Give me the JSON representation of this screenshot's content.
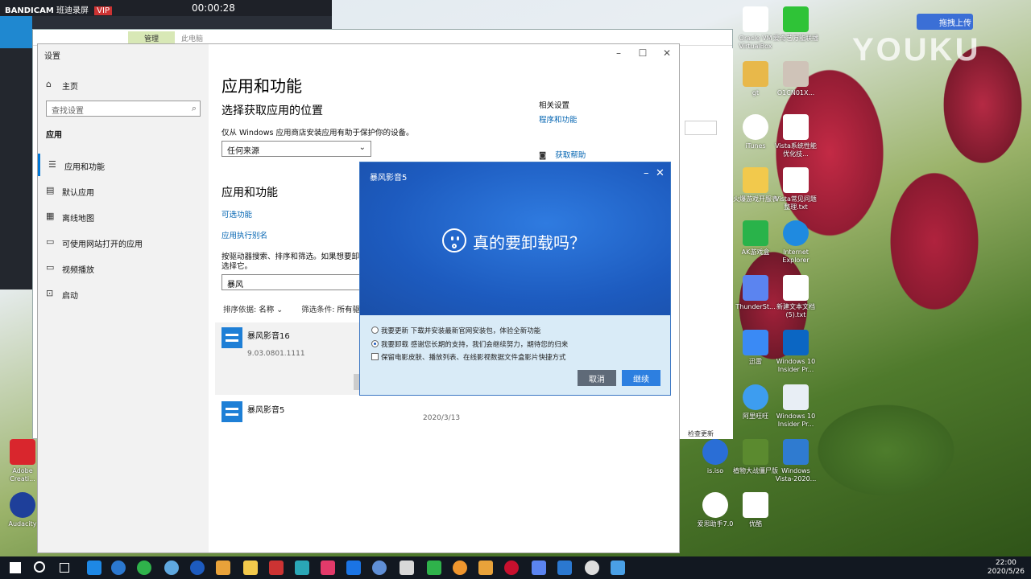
{
  "desktop": {
    "brand": "YOUKU",
    "upload_label": "拖拽上传",
    "icons": [
      {
        "label": "Oracle VM VirtualBox"
      },
      {
        "label": "爱奇艺万能联播"
      },
      {
        "label": "gt"
      },
      {
        "label": "O1CN01X..."
      },
      {
        "label": "iTunes"
      },
      {
        "label": "Vista系统性能优化技..."
      },
      {
        "label": "火爆游戏开服表"
      },
      {
        "label": "Vista常见问题整理.txt"
      },
      {
        "label": "AK游戏盒"
      },
      {
        "label": "Internet Explorer"
      },
      {
        "label": "ThunderSt..."
      },
      {
        "label": "新建文本文档(5).txt"
      },
      {
        "label": "迅雷"
      },
      {
        "label": "Windows 10 Insider Pr..."
      },
      {
        "label": "阿里旺旺"
      },
      {
        "label": "Windows 10 Insider Pr..."
      },
      {
        "label": "is.iso"
      },
      {
        "label": "植物大战僵尸版"
      },
      {
        "label": "Windows Vista-2020..."
      },
      {
        "label": "爱思助手7.0"
      },
      {
        "label": "优酷"
      },
      {
        "label": "Adobe Creati..."
      },
      {
        "label": "Audacity"
      }
    ]
  },
  "bandicam": {
    "title": "BANDICAM",
    "sub": "班迪录屏",
    "vip": "VIP",
    "timer": "00:00:28"
  },
  "explorer": {
    "manage": "管理",
    "location": "此电脑",
    "update": "检查更新"
  },
  "settings": {
    "window_title": "设置",
    "nav": {
      "home": "主页",
      "search_placeholder": "查找设置",
      "section": "应用",
      "items": [
        {
          "label": "应用和功能"
        },
        {
          "label": "默认应用"
        },
        {
          "label": "离线地图"
        },
        {
          "label": "可使用网站打开的应用"
        },
        {
          "label": "视频播放"
        },
        {
          "label": "启动"
        }
      ]
    },
    "main": {
      "title": "应用和功能",
      "location_heading": "选择获取应用的位置",
      "location_desc": "仅从 Windows 应用商店安装应用有助于保护你的设备。",
      "location_value": "任何来源",
      "apps_heading": "应用和功能",
      "optional_features": "可选功能",
      "app_aliases": "应用执行别名",
      "search_desc_1": "按驱动器搜索、排序和筛选。如果想要卸载",
      "search_desc_2": "选择它。",
      "filter_value": "暴风",
      "sort_label": "排序依据:",
      "sort_value": "名称",
      "filter_label": "筛选条件:",
      "filter_option": "所有驱",
      "apps": [
        {
          "name": "暴风影音16",
          "version": "9.03.0801.1111"
        },
        {
          "name": "暴风影音5",
          "date": "2020/3/13"
        }
      ]
    },
    "related": {
      "heading": "相关设置",
      "link": "程序和功能",
      "help": "获取帮助"
    }
  },
  "dialog": {
    "title": "暴风影音5",
    "question": "真的要卸载吗？",
    "option1": "我要更新 下载并安装最新官网安装包，体验全新功能",
    "option2": "我要卸载 感谢您长期的支持，我们会继续努力，期待您的归来",
    "checkbox": "保留电影皮肤、播放列表、在线影视数据文件盒影片快捷方式",
    "cancel": "取消",
    "continue": "继续"
  },
  "taskbar": {
    "time": "22:00",
    "date": "2020/5/26"
  }
}
